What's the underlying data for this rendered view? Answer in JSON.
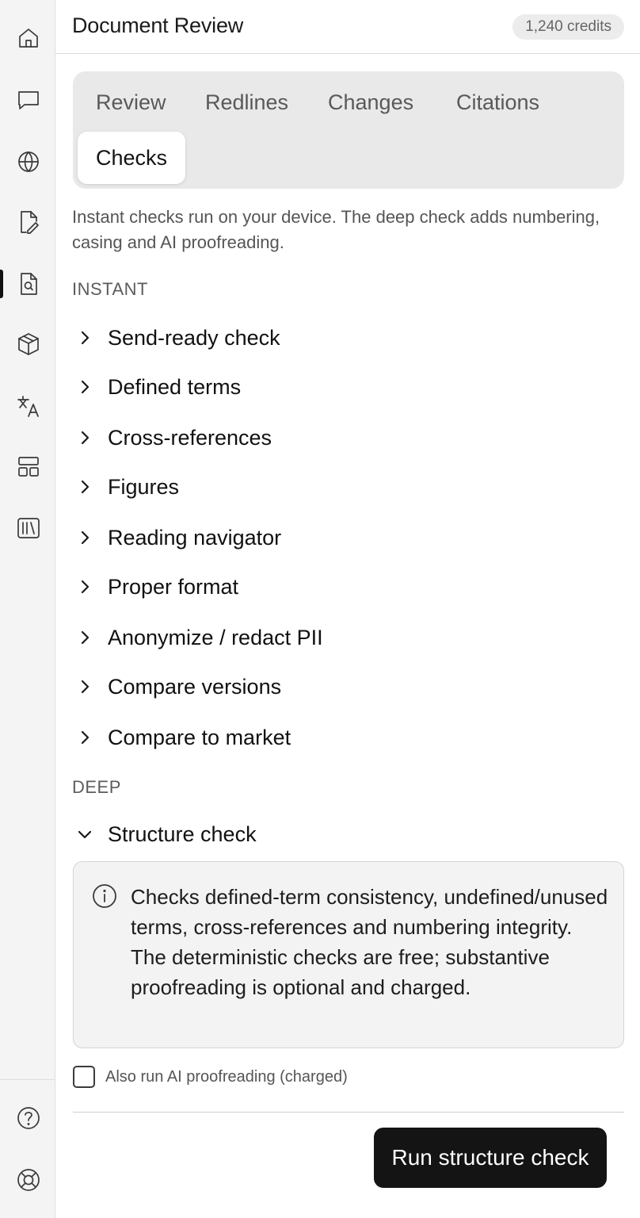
{
  "header": {
    "title": "Document Review",
    "credits": "1,240 credits"
  },
  "rail": {
    "icons": [
      "home-icon",
      "chat-icon",
      "globe-icon",
      "edit-file-icon",
      "search-file-icon",
      "cube-icon",
      "translate-icon",
      "layout-icon",
      "library-icon",
      "help-icon",
      "lifebuoy-icon"
    ],
    "active": "search-file-icon"
  },
  "tabs": [
    {
      "label": "Review"
    },
    {
      "label": "Redlines"
    },
    {
      "label": "Changes"
    },
    {
      "label": "Citations"
    },
    {
      "label": "Checks",
      "active": true
    }
  ],
  "description": "Instant checks run on your device. The deep check adds numbering, casing and AI proofreading.",
  "sections": {
    "instant_label": "INSTANT",
    "instant_items": [
      "Send-ready check",
      "Defined terms",
      "Cross-references",
      "Figures",
      "Reading navigator",
      "Proper format",
      "Anonymize / redact PII",
      "Compare versions",
      "Compare to market"
    ],
    "deep_label": "DEEP",
    "deep_item": "Structure check"
  },
  "structure_check": {
    "info": "Checks defined-term consistency, undefined/unused terms, cross-references and numbering integrity. The deterministic checks are free; substantive proofreading is optional and charged.",
    "ai_option_label": "Also run AI proofreading (charged)",
    "ai_option_checked": false,
    "run_label": "Run structure check"
  }
}
